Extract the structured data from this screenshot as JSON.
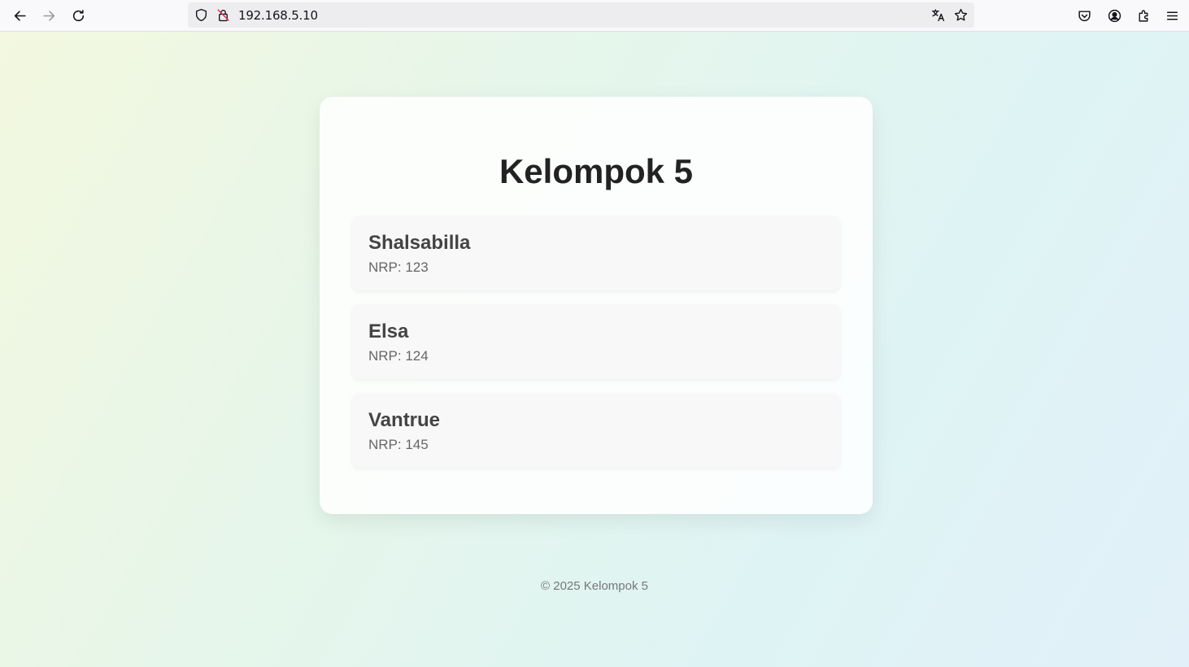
{
  "browser": {
    "url": "192.168.5.10",
    "icons": [
      "back-icon",
      "forward-icon",
      "reload-icon",
      "shield-icon",
      "insecure-lock-icon",
      "translate-icon",
      "bookmark-star-icon",
      "pocket-icon",
      "account-icon",
      "extensions-icon",
      "menu-icon"
    ]
  },
  "page": {
    "title": "Kelompok 5",
    "members": [
      {
        "name": "Shalsabilla",
        "nrp": "NRP: 123"
      },
      {
        "name": "Elsa",
        "nrp": "NRP: 124"
      },
      {
        "name": "Vantrue",
        "nrp": "NRP: 145"
      }
    ],
    "footer": "© 2025 Kelompok 5"
  },
  "colors": {
    "title": "#222222",
    "name": "#444444",
    "nrp": "#666666",
    "footer": "#777777"
  }
}
